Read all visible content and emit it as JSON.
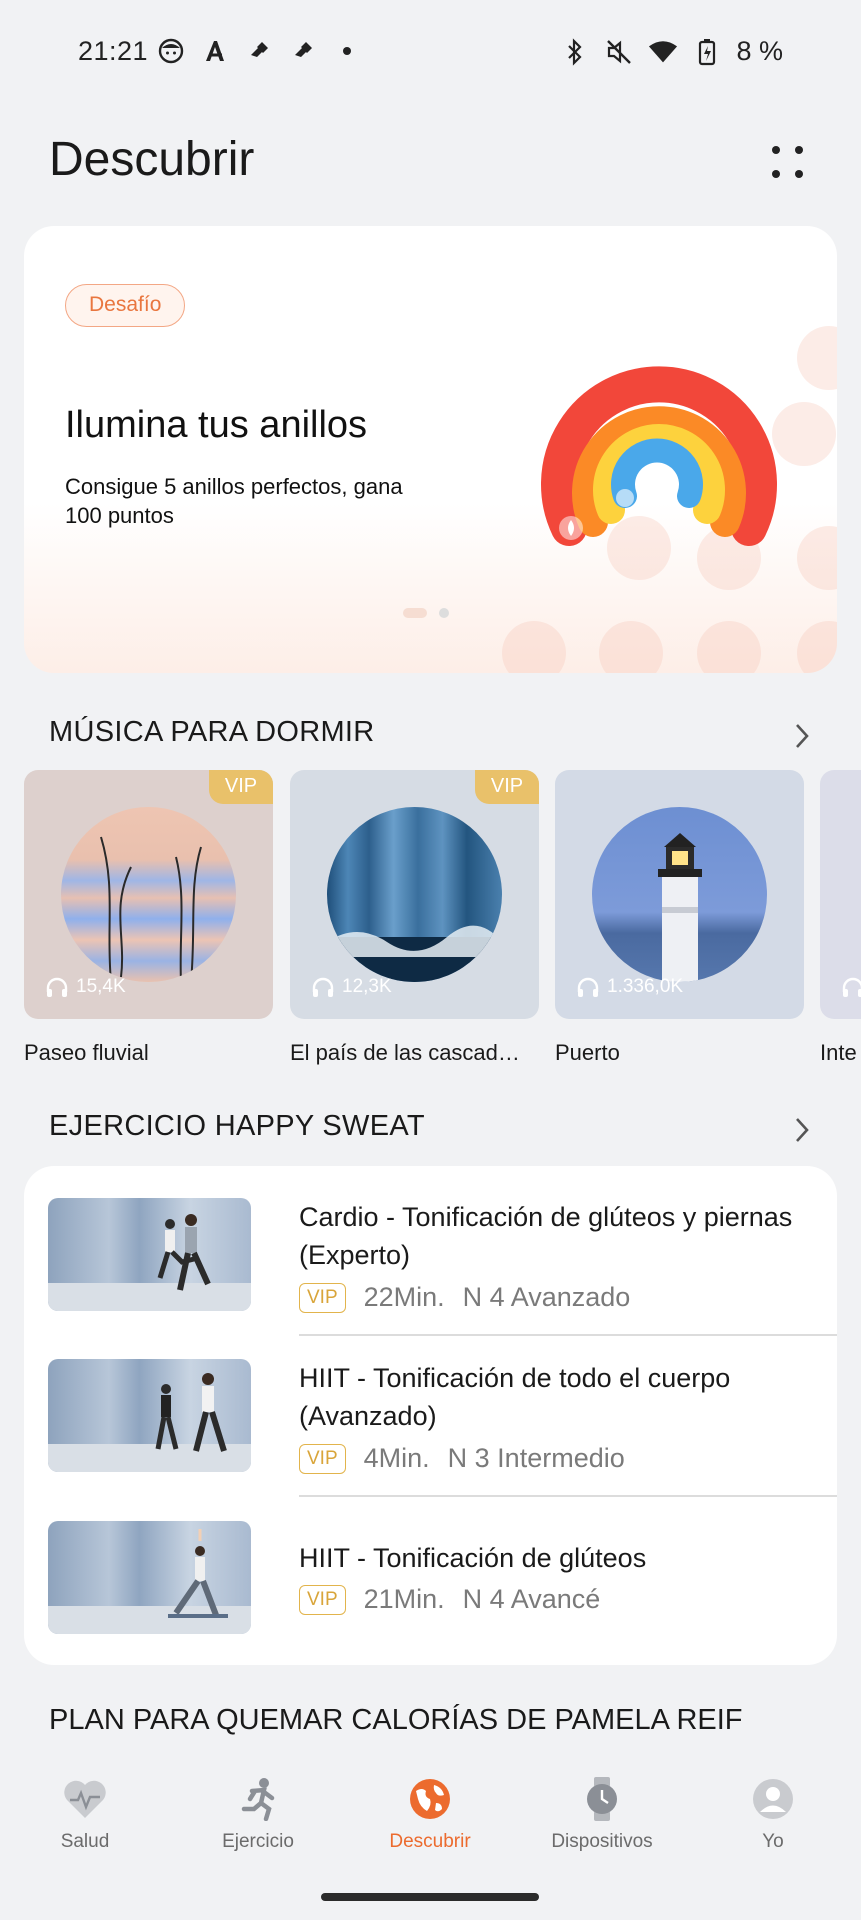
{
  "status_bar": {
    "time": "21:21",
    "battery": "8 %",
    "left_icons": [
      "face-icon",
      "a-icon",
      "tiktok-icon",
      "tiktok-icon",
      "dot-icon"
    ],
    "right_icons": [
      "bluetooth-icon",
      "mute-icon",
      "wifi-icon",
      "battery-icon"
    ]
  },
  "header": {
    "title": "Descubrir",
    "more_icon": "more-dots-icon"
  },
  "banner": {
    "badge": "Desafío",
    "title": "Ilumina tus anillos",
    "subtitle": "Consigue 5 anillos perfectos, gana 100 puntos",
    "pages": 2,
    "active_page": 1,
    "colors": [
      "#f2473a",
      "#fb8a26",
      "#fdd23d",
      "#4aa8ea"
    ]
  },
  "music_section": {
    "title": "MÚSICA PARA DORMIR",
    "items": [
      {
        "title": "Paseo fluvial",
        "plays": "15,4K",
        "vip": "VIP"
      },
      {
        "title": "El país de las cascad…",
        "plays": "12,3K",
        "vip": "VIP"
      },
      {
        "title": "Puerto",
        "plays": "1.336,0K",
        "vip": ""
      },
      {
        "title": "Inte",
        "plays": "",
        "vip": ""
      }
    ]
  },
  "workout_section": {
    "title": "EJERCICIO HAPPY SWEAT",
    "items": [
      {
        "title": "Cardio - Tonificación de glúteos y piernas (Experto)",
        "vip": "VIP",
        "duration": "22Min.",
        "level": "N 4 Avanzado"
      },
      {
        "title": "HIIT - Tonificación de todo el cuerpo (Avanzado)",
        "vip": "VIP",
        "duration": "4Min.",
        "level": "N 3 Intermedio"
      },
      {
        "title": "HIIT - Tonificación de glúteos",
        "vip": "VIP",
        "duration": "21Min.",
        "level": "N 4 Avancé"
      }
    ]
  },
  "plan_section": {
    "title": "PLAN PARA QUEMAR CALORÍAS DE PAMELA REIF"
  },
  "bottom_nav": {
    "items": [
      {
        "label": "Salud",
        "icon": "heart-icon"
      },
      {
        "label": "Ejercicio",
        "icon": "running-icon"
      },
      {
        "label": "Descubrir",
        "icon": "globe-icon",
        "active": true
      },
      {
        "label": "Dispositivos",
        "icon": "watch-icon"
      },
      {
        "label": "Yo",
        "icon": "profile-icon"
      }
    ],
    "active_color": "#ec6b2e"
  }
}
